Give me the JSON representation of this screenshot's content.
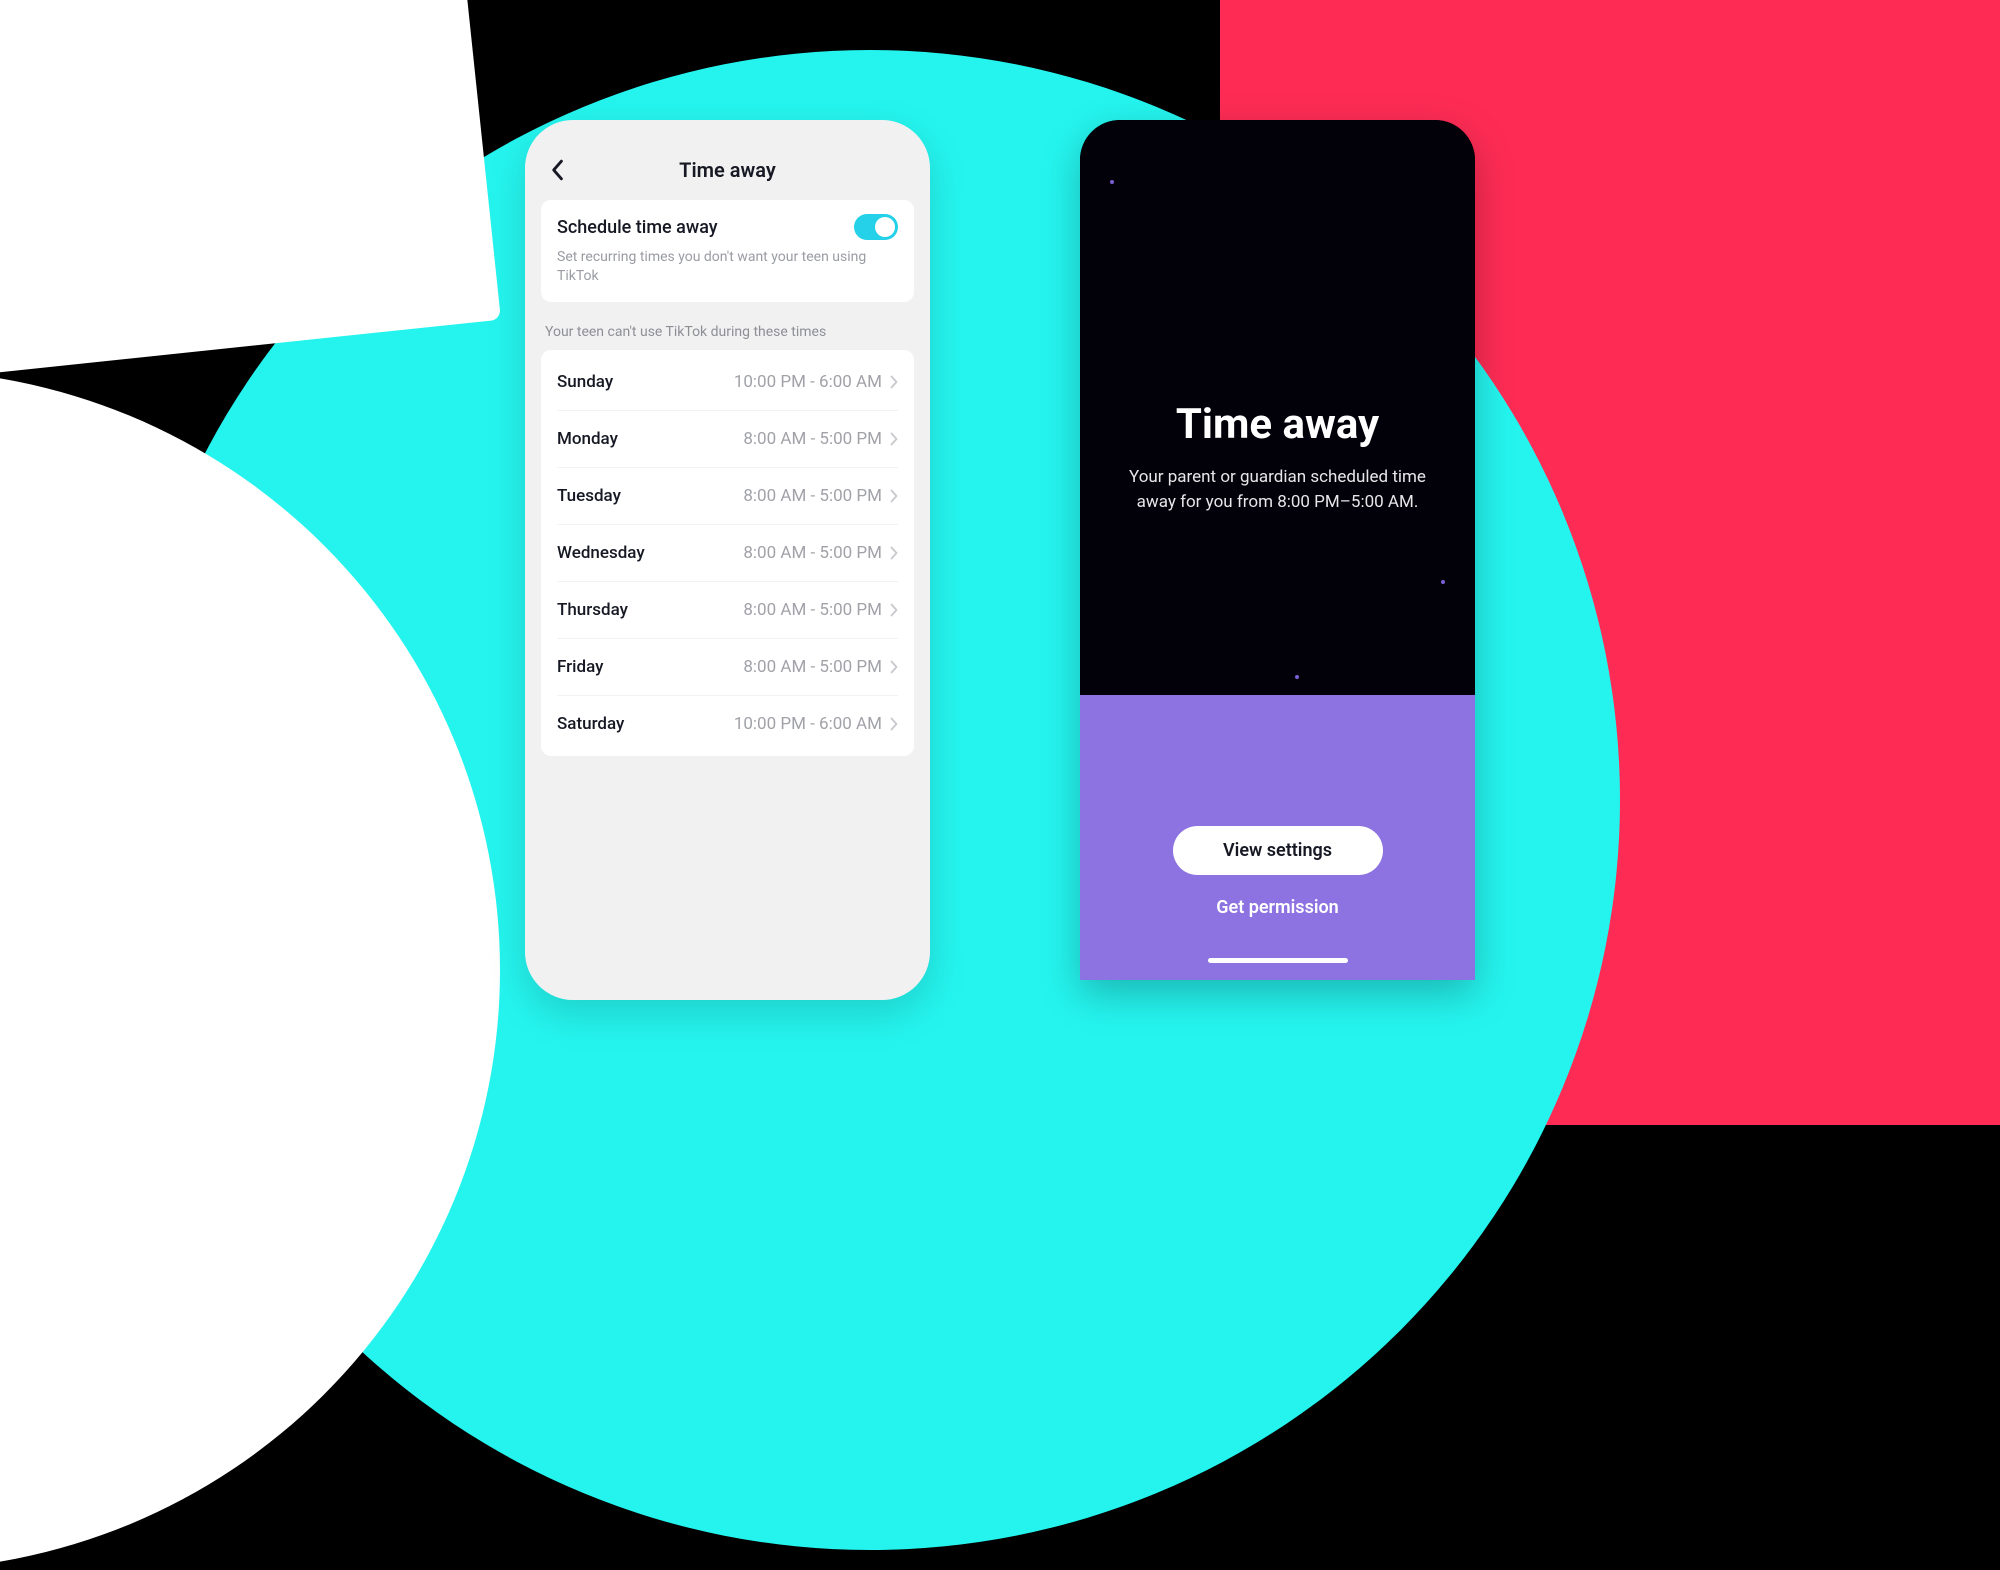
{
  "settings": {
    "header_title": "Time away",
    "toggle_label": "Schedule time away",
    "toggle_desc": "Set recurring times you don't want your teen using TikTok",
    "toggle_on": true,
    "section_label": "Your teen can't use TikTok during these times",
    "days": [
      {
        "name": "Sunday",
        "time": "10:00 PM - 6:00 AM"
      },
      {
        "name": "Monday",
        "time": "8:00 AM - 5:00 PM"
      },
      {
        "name": "Tuesday",
        "time": "8:00 AM - 5:00 PM"
      },
      {
        "name": "Wednesday",
        "time": "8:00 AM - 5:00 PM"
      },
      {
        "name": "Thursday",
        "time": "8:00 AM - 5:00 PM"
      },
      {
        "name": "Friday",
        "time": "8:00 AM - 5:00 PM"
      },
      {
        "name": "Saturday",
        "time": "10:00 PM - 6:00 AM"
      }
    ]
  },
  "lock": {
    "title": "Time away",
    "description": "Your parent or guardian scheduled time away for you from 8:00 PM–5:00 AM.",
    "primary_button": "View settings",
    "secondary_button": "Get permission"
  },
  "colors": {
    "cyan": "#25f4ee",
    "pink": "#fe2c55",
    "purple": "#8d72e1"
  }
}
